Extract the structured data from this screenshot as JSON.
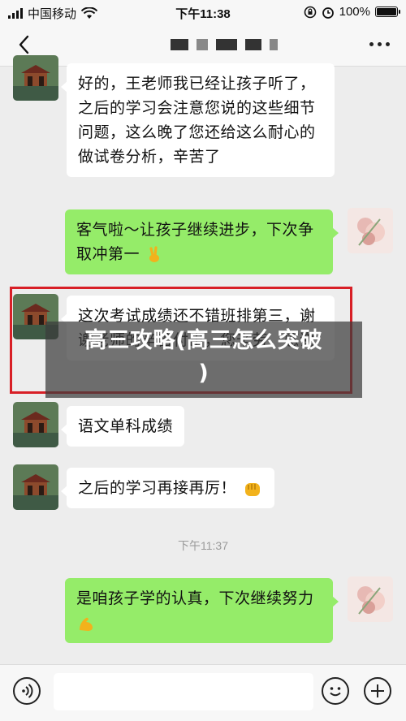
{
  "status_bar": {
    "carrier": "中国移动",
    "time": "下午11:38",
    "battery": "100%",
    "battery_level": 1.0
  },
  "nav": {
    "back_icon": "chevron-left-icon",
    "more_icon": "more-dots-icon"
  },
  "messages": [
    {
      "side": "left",
      "text": "好的，王老师我已经让孩子听了，之后的学习会注意您说的这些细节问题，这么晚了您还给这么耐心的做试卷分析，辛苦了"
    },
    {
      "side": "right",
      "text": "客气啦～让孩子继续进步，下次争取冲第一"
    },
    {
      "side": "left",
      "text": "这次考试成绩还不错班排第三，谢谢老师的辛苦付出，您辛劳，感谢"
    },
    {
      "side": "left",
      "text": "语文单科成绩"
    },
    {
      "side": "left",
      "text": "之后的学习再接再厉！"
    },
    {
      "side": "right",
      "text": "是咱孩子学的认真，下次继续努力"
    }
  ],
  "timestamp": "下午11:37",
  "overlay": {
    "title_line1": "高三攻略(高三怎么突破",
    "title_line2": ")"
  },
  "input_bar": {
    "voice_icon": "voice-icon",
    "emoji_icon": "smiley-icon",
    "plus_icon": "plus-icon",
    "placeholder": ""
  },
  "colors": {
    "sent_bubble": "#95ec69",
    "received_bubble": "#ffffff",
    "highlight_border": "#d81f26",
    "background": "#ededed"
  }
}
